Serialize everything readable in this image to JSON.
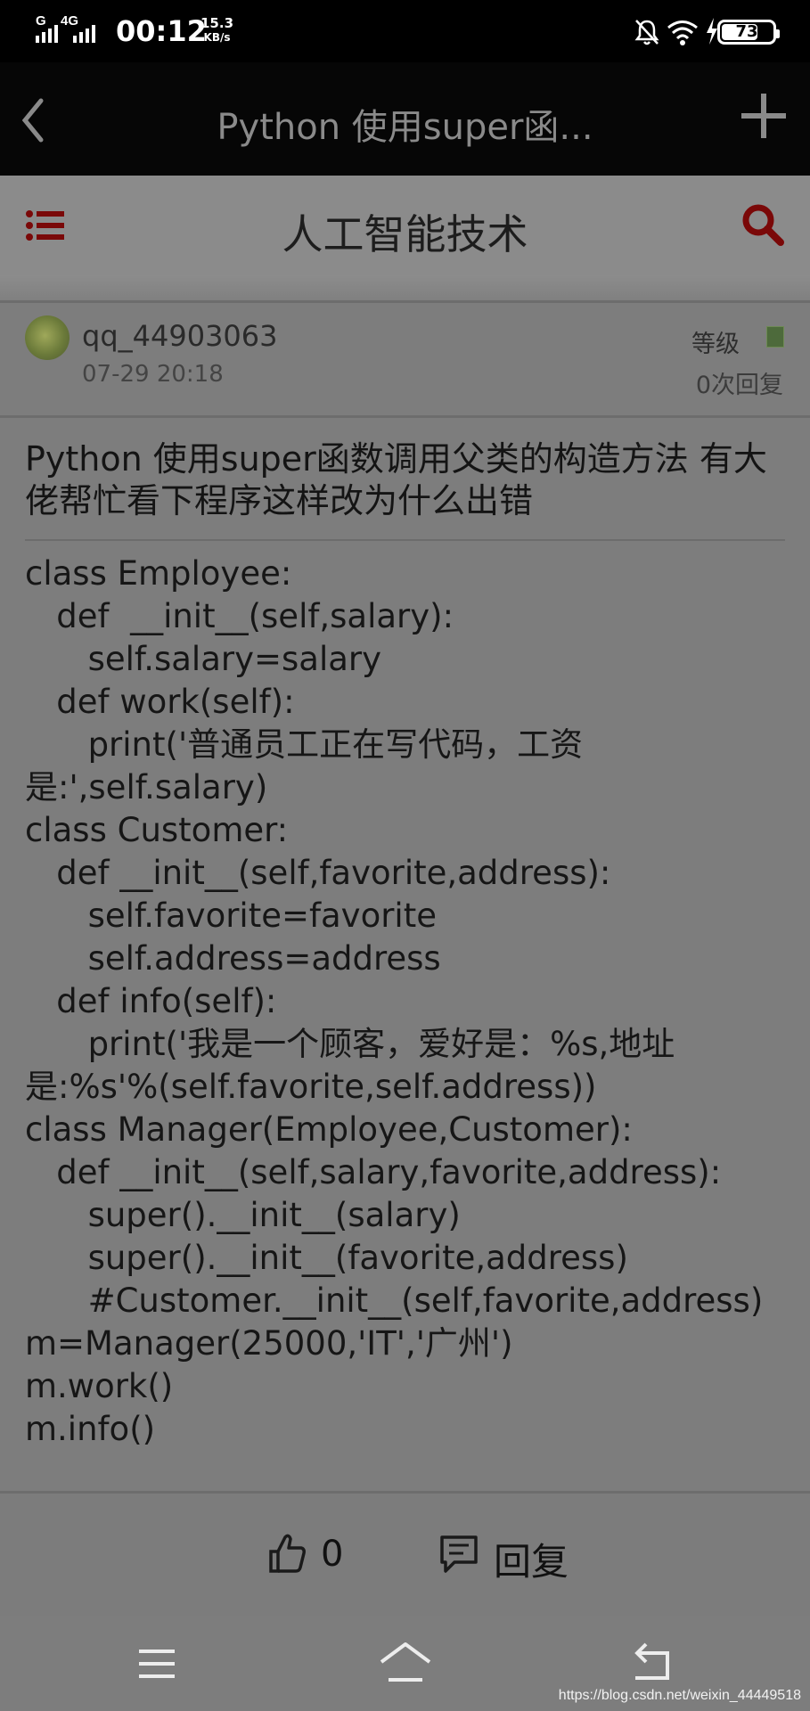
{
  "status_bar": {
    "network": "4G",
    "network_g": "G",
    "time": "00:12",
    "speed_value": "15.3",
    "speed_unit": "KB/s",
    "battery": "73"
  },
  "title_bar": {
    "title": "Python 使用super函..."
  },
  "forum": {
    "title": "人工智能技术"
  },
  "post": {
    "username": "qq_44903063",
    "time": "07-29 20:18",
    "level_label": "等级",
    "reply_count": "0次回复",
    "title": "Python 使用super函数调用父类的构造方法 有大佬帮忙看下程序这样改为什么出错",
    "body_lines": [
      "class Employee:",
      "   def  __init__(self,salary):",
      "      self.salary=salary",
      "   def work(self):",
      "      print('普通员工正在写代码，工资",
      "是:',self.salary)",
      "class Customer:",
      "   def __init__(self,favorite,address):",
      "      self.favorite=favorite",
      "      self.address=address",
      "   def info(self):",
      "      print('我是一个顾客，爱好是：%s,地址",
      "是:%s'%(self.favorite,self.address))",
      "class Manager(Employee,Customer):",
      "   def __init__(self,salary,favorite,address):",
      "      super().__init__(salary)",
      "      super().__init__(favorite,address)",
      "      #Customer.__init__(self,favorite,address)",
      "m=Manager(25000,'IT','广州')",
      "m.work()",
      "m.info()"
    ]
  },
  "actions": {
    "like_count": "0",
    "reply_label": "回复"
  },
  "watermark": "https://blog.csdn.net/weixin_44449518",
  "colors": {
    "accent": "#8b0000",
    "overlay_gray": "#7d7d7d"
  }
}
